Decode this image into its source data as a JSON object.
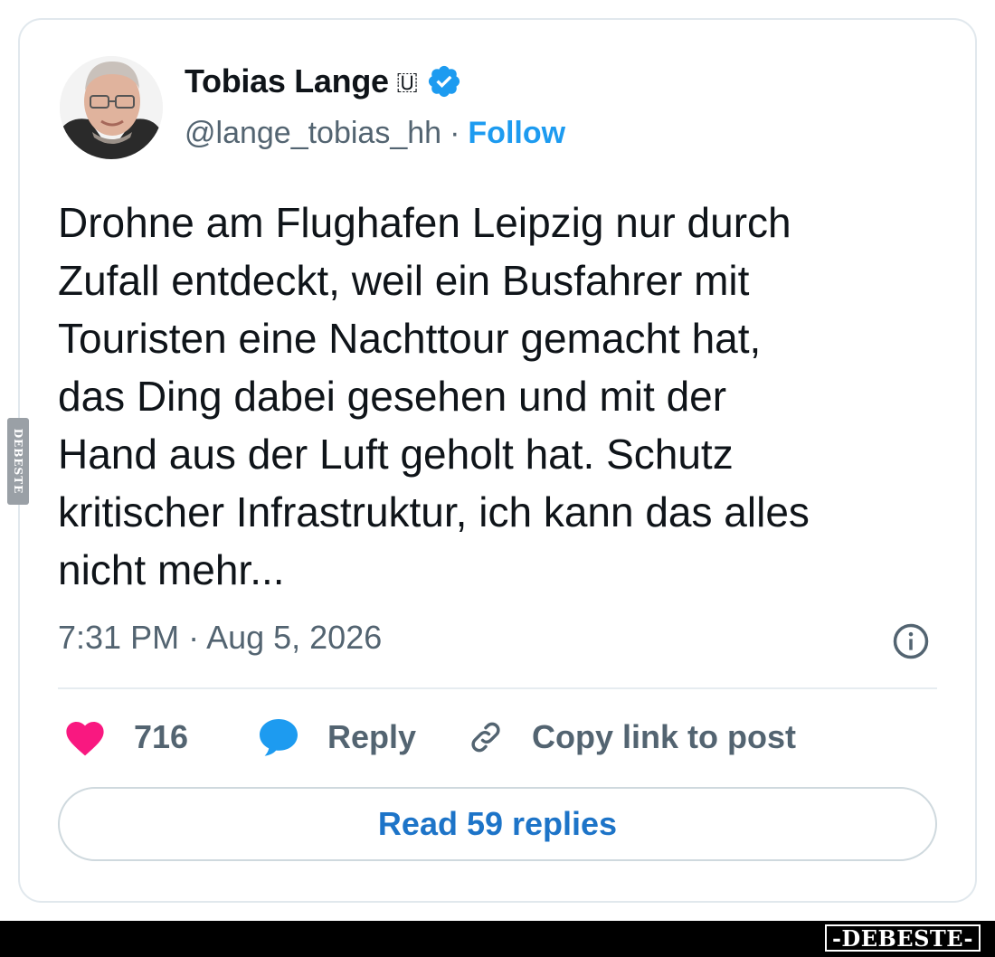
{
  "author": {
    "name": "Tobias Lange",
    "name_emoji": "🇺",
    "handle": "@lange_tobias_hh",
    "separator": "·",
    "follow_label": "Follow",
    "verified_icon": "verified-badge-icon"
  },
  "tweet": {
    "lines": [
      "Drohne am Flughafen Leipzig nur durch",
      "Zufall entdeckt, weil ein Busfahrer mit",
      "Touristen eine Nachttour gemacht hat,",
      "das Ding dabei gesehen und mit der",
      "Hand aus der Luft geholt hat. Schutz",
      "kritischer Infrastruktur, ich kann das alles",
      "nicht mehr..."
    ],
    "timestamp": "7:31 PM · Aug 5, 2026"
  },
  "actions": {
    "like_count": "716",
    "reply_label": "Reply",
    "copy_label": "Copy link to post"
  },
  "read_replies_label": "Read 59 replies",
  "watermark": {
    "side": "DEBESTE",
    "footer": "-DEBESTE-"
  },
  "colors": {
    "accent": "#1d9bf0",
    "heart": "#f91880",
    "muted": "#536471",
    "text": "#0f1419",
    "border": "#e1e8ed"
  }
}
